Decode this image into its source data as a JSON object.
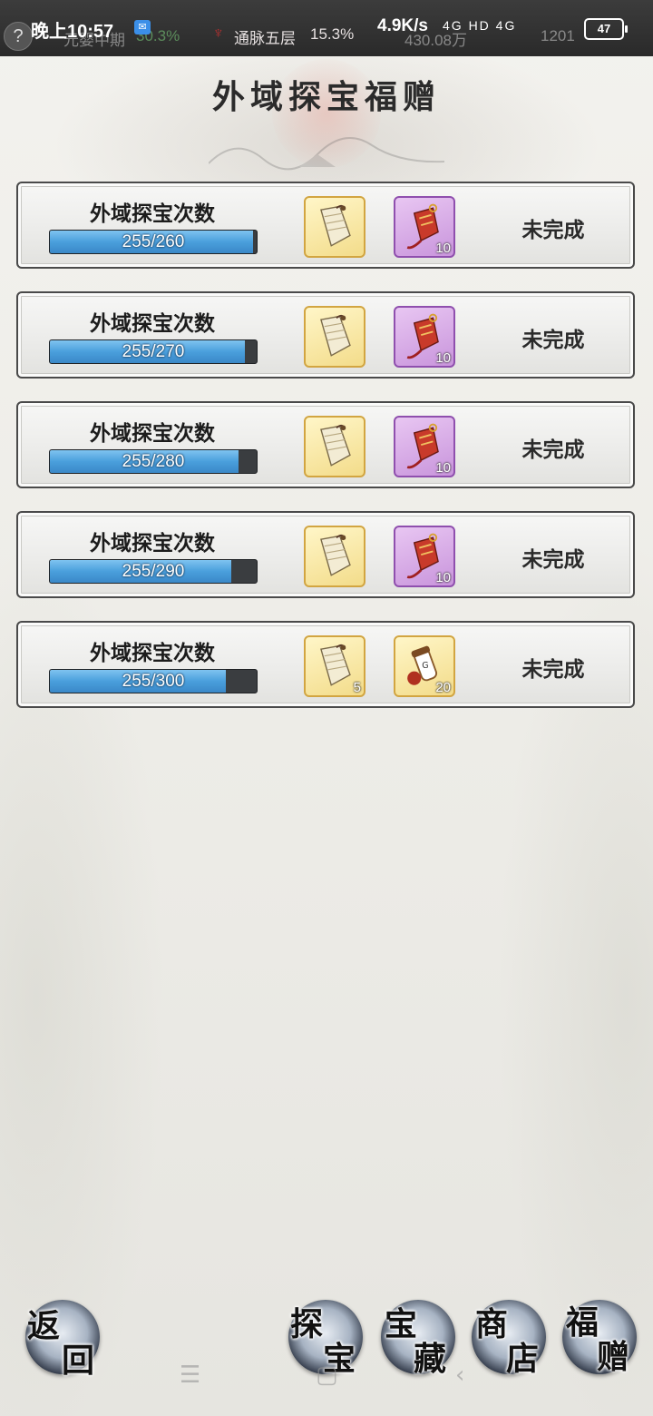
{
  "status_bar": {
    "help": "?",
    "time": "晚上10:57",
    "ghost_stage": "元婴中期",
    "ghost_stage_pct": "30.3%",
    "realm": "通脉五层",
    "realm_pct": "15.3%",
    "speed": "4.9K/s",
    "ghost_money": "430.08万",
    "ghost_gold": "1201",
    "net": "4G HD 4G",
    "battery": "47"
  },
  "title": "外域探宝福赠",
  "tasks": [
    {
      "label": "外域探宝次数",
      "current": 255,
      "total": 260,
      "progress_text": "255/260",
      "reward1_count": "",
      "reward2_count": "10",
      "reward2_type": "purple",
      "status": "未完成"
    },
    {
      "label": "外域探宝次数",
      "current": 255,
      "total": 270,
      "progress_text": "255/270",
      "reward1_count": "",
      "reward2_count": "10",
      "reward2_type": "purple",
      "status": "未完成"
    },
    {
      "label": "外域探宝次数",
      "current": 255,
      "total": 280,
      "progress_text": "255/280",
      "reward1_count": "",
      "reward2_count": "10",
      "reward2_type": "purple",
      "status": "未完成"
    },
    {
      "label": "外域探宝次数",
      "current": 255,
      "total": 290,
      "progress_text": "255/290",
      "reward1_count": "",
      "reward2_count": "10",
      "reward2_type": "purple",
      "status": "未完成"
    },
    {
      "label": "外域探宝次数",
      "current": 255,
      "total": 300,
      "progress_text": "255/300",
      "reward1_count": "5",
      "reward2_count": "20",
      "reward2_type": "gold",
      "status": "未完成"
    }
  ],
  "buttons": {
    "back": [
      "返",
      "回"
    ],
    "explore": [
      "探",
      "宝"
    ],
    "treasure": [
      "宝",
      "藏"
    ],
    "shop": [
      "商",
      "店"
    ],
    "gift": [
      "福",
      "赠"
    ]
  },
  "icons": {
    "reward1": "scroll-map-icon",
    "reward2_purple": "red-talisman-icon",
    "reward2_gold": "pill-scroll-icon"
  }
}
